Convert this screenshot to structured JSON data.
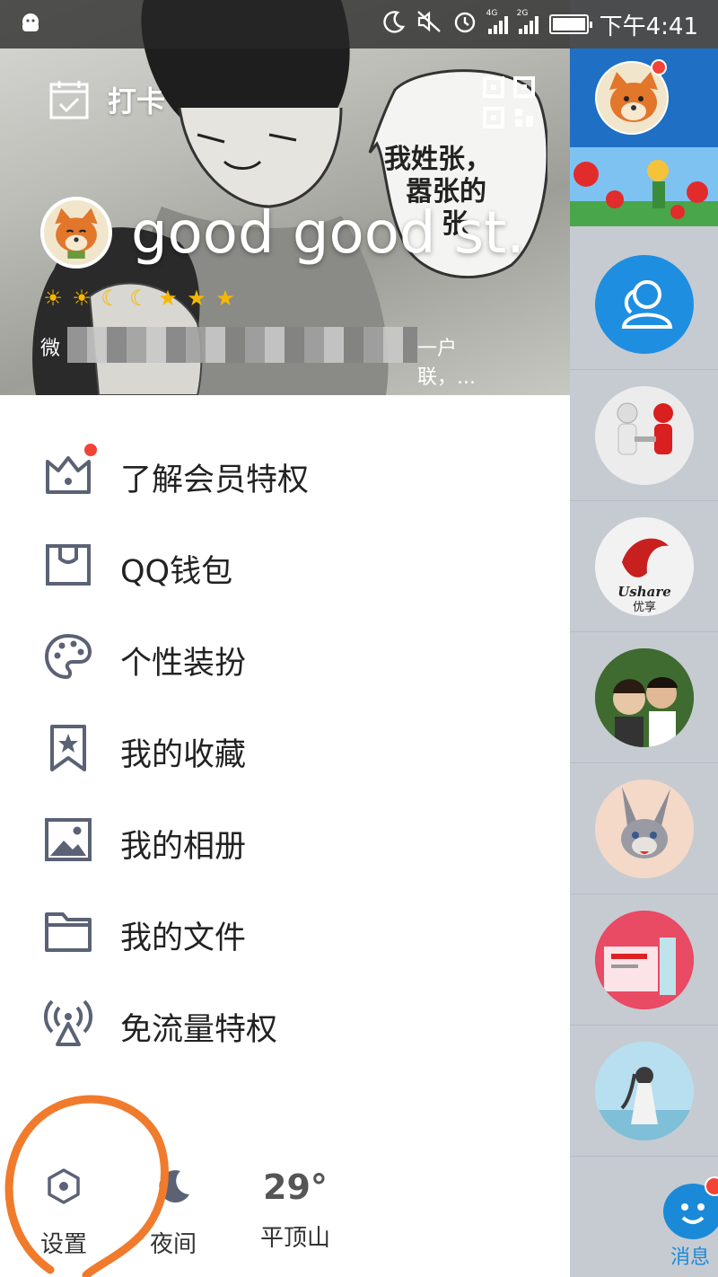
{
  "status_bar": {
    "time": "下午4:41",
    "network_1": "4G",
    "network_2": "2G",
    "icons": [
      "qq-ghost-icon",
      "moon-icon",
      "mute-icon",
      "alarm-icon",
      "signal-icon",
      "signal-icon",
      "battery-icon"
    ]
  },
  "header": {
    "checkin_label": "打卡",
    "nickname": "good good st...",
    "signature_start": "微",
    "signature_end": "一户联，...",
    "bubble_text_line1": "我姓张，",
    "bubble_text_line2": "嚣张的",
    "bubble_text_line3": "张"
  },
  "menu": [
    {
      "label": "了解会员特权",
      "icon": "crown-icon",
      "badge": true
    },
    {
      "label": "QQ钱包",
      "icon": "wallet-icon",
      "badge": false
    },
    {
      "label": "个性装扮",
      "icon": "palette-icon",
      "badge": false
    },
    {
      "label": "我的收藏",
      "icon": "bookmark-star-icon",
      "badge": false
    },
    {
      "label": "我的相册",
      "icon": "image-icon",
      "badge": false
    },
    {
      "label": "我的文件",
      "icon": "folder-icon",
      "badge": false
    },
    {
      "label": "免流量特权",
      "icon": "broadcast-icon",
      "badge": false
    }
  ],
  "bottom": {
    "settings_label": "设置",
    "night_label": "夜间",
    "temperature": "29°",
    "city": "平顶山"
  },
  "main_screen": {
    "tab_label": "消息",
    "brand_text": "Ushare",
    "brand_sub": "优享"
  },
  "colors": {
    "accent": "#1a8ad8",
    "badge": "#f44236",
    "annotation": "#f07b2c",
    "icon_gray": "#5b6275"
  }
}
